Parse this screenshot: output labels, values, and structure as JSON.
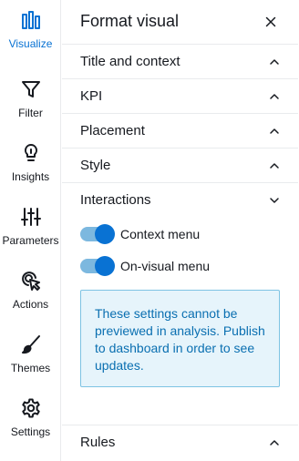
{
  "rail": {
    "items": [
      {
        "label": "Visualize",
        "icon": "bar-chart-icon",
        "active": true
      },
      {
        "label": "Filter",
        "icon": "filter-icon",
        "active": false
      },
      {
        "label": "Insights",
        "icon": "lightbulb-icon",
        "active": false
      },
      {
        "label": "Parameters",
        "icon": "sliders-icon",
        "active": false
      },
      {
        "label": "Actions",
        "icon": "cursor-click-icon",
        "active": false
      },
      {
        "label": "Themes",
        "icon": "brush-icon",
        "active": false
      },
      {
        "label": "Settings",
        "icon": "gear-icon",
        "active": false
      }
    ]
  },
  "panel": {
    "title": "Format visual",
    "sections": [
      {
        "label": "Title and context",
        "expanded": false
      },
      {
        "label": "KPI",
        "expanded": false
      },
      {
        "label": "Placement",
        "expanded": false
      },
      {
        "label": "Style",
        "expanded": false
      },
      {
        "label": "Interactions",
        "expanded": true
      },
      {
        "label": "Rules",
        "expanded": false
      }
    ],
    "interactions": {
      "toggles": [
        {
          "label": "Context menu",
          "on": true
        },
        {
          "label": "On-visual menu",
          "on": true
        }
      ],
      "info": "These settings cannot be previewed in analysis. Publish to dashboard in order to see updates."
    }
  },
  "colors": {
    "accent": "#0972d3",
    "toggle_track": "#7cb8df",
    "info_bg": "#e6f4fb",
    "info_border": "#7ec3e3",
    "info_text": "#0a6fb1",
    "divider": "#e9ebed"
  }
}
